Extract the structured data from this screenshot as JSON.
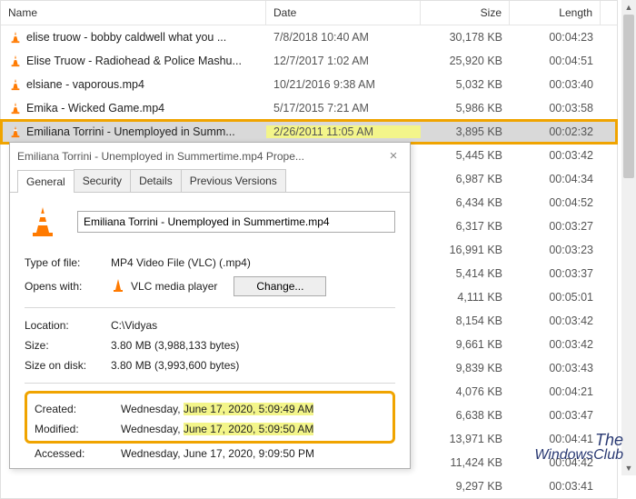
{
  "columns": {
    "name": "Name",
    "date": "Date",
    "size": "Size",
    "length": "Length"
  },
  "files": [
    {
      "name": "elise truow - bobby caldwell what you ...",
      "date": "7/8/2018 10:40 AM",
      "size": "30,178 KB",
      "length": "00:04:23"
    },
    {
      "name": "Elise Truow - Radiohead & Police Mashu...",
      "date": "12/7/2017 1:02 AM",
      "size": "25,920 KB",
      "length": "00:04:51"
    },
    {
      "name": "elsiane - vaporous.mp4",
      "date": "10/21/2016 9:38 AM",
      "size": "5,032 KB",
      "length": "00:03:40"
    },
    {
      "name": "Emika - Wicked Game.mp4",
      "date": "5/17/2015 7:21 AM",
      "size": "5,986 KB",
      "length": "00:03:58"
    },
    {
      "name": "Emiliana Torrini - Unemployed in Summ...",
      "date": "2/26/2011 11:05 AM",
      "size": "3,895 KB",
      "length": "00:02:32"
    },
    {
      "name": "",
      "date": "",
      "size": "5,445 KB",
      "length": "00:03:42"
    },
    {
      "name": "",
      "date": "",
      "size": "6,987 KB",
      "length": "00:04:34"
    },
    {
      "name": "",
      "date": "",
      "size": "6,434 KB",
      "length": "00:04:52"
    },
    {
      "name": "",
      "date": "",
      "size": "6,317 KB",
      "length": "00:03:27"
    },
    {
      "name": "",
      "date": "",
      "size": "16,991 KB",
      "length": "00:03:23"
    },
    {
      "name": "",
      "date": "",
      "size": "5,414 KB",
      "length": "00:03:37"
    },
    {
      "name": "",
      "date": "",
      "size": "4,111 KB",
      "length": "00:05:01"
    },
    {
      "name": "",
      "date": "",
      "size": "8,154 KB",
      "length": "00:03:42"
    },
    {
      "name": "",
      "date": "",
      "size": "9,661 KB",
      "length": "00:03:42"
    },
    {
      "name": "",
      "date": "",
      "size": "9,839 KB",
      "length": "00:03:43"
    },
    {
      "name": "",
      "date": "",
      "size": "4,076 KB",
      "length": "00:04:21"
    },
    {
      "name": "",
      "date": "",
      "size": "6,638 KB",
      "length": "00:03:47"
    },
    {
      "name": "",
      "date": "",
      "size": "13,971 KB",
      "length": "00:04:41"
    },
    {
      "name": "",
      "date": "",
      "size": "11,424 KB",
      "length": "00:04:42"
    },
    {
      "name": "",
      "date": "",
      "size": "9,297 KB",
      "length": "00:03:41"
    }
  ],
  "selected_index": 4,
  "props": {
    "title": "Emiliana Torrini - Unemployed in Summertime.mp4 Prope...",
    "tabs": {
      "general": "General",
      "security": "Security",
      "details": "Details",
      "previous": "Previous Versions"
    },
    "filename": "Emiliana Torrini - Unemployed in Summertime.mp4",
    "labels": {
      "type": "Type of file:",
      "opens": "Opens with:",
      "change": "Change...",
      "location": "Location:",
      "size": "Size:",
      "disk": "Size on disk:",
      "created": "Created:",
      "modified": "Modified:",
      "accessed": "Accessed:"
    },
    "values": {
      "type": "MP4 Video File (VLC) (.mp4)",
      "opens": "VLC media player",
      "location": "C:\\Vidyas",
      "size": "3.80 MB (3,988,133 bytes)",
      "disk": "3.80 MB (3,993,600 bytes)",
      "created_pre": "Wednesday, ",
      "created_hl": "June 17, 2020, 5:09:49 AM",
      "modified_pre": "Wednesday, ",
      "modified_hl": "June 17, 2020, 5:09:50 AM",
      "accessed": "Wednesday, June 17, 2020, 9:09:50 PM"
    }
  },
  "watermark": {
    "line1": "The",
    "line2": "WindowsClub"
  }
}
